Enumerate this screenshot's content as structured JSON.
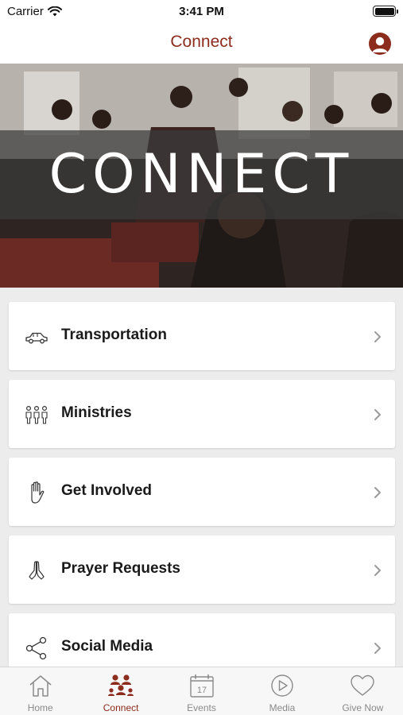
{
  "status_bar": {
    "carrier": "Carrier",
    "time": "3:41 PM"
  },
  "nav": {
    "title": "Connect",
    "profile_icon": "user-profile-icon"
  },
  "hero": {
    "banner_text": "CONNECT"
  },
  "menu": {
    "items": [
      {
        "label": "Transportation",
        "icon": "car-icon"
      },
      {
        "label": "Ministries",
        "icon": "people-group-icon"
      },
      {
        "label": "Get Involved",
        "icon": "raised-hand-icon"
      },
      {
        "label": "Prayer Requests",
        "icon": "praying-hands-icon"
      },
      {
        "label": "Social Media",
        "icon": "share-icon"
      }
    ]
  },
  "tab_bar": {
    "tabs": [
      {
        "label": "Home",
        "icon": "home-icon"
      },
      {
        "label": "Connect",
        "icon": "connect-people-icon",
        "active": true
      },
      {
        "label": "Events",
        "icon": "calendar-icon",
        "calendar_day": "17"
      },
      {
        "label": "Media",
        "icon": "play-icon"
      },
      {
        "label": "Give Now",
        "icon": "heart-icon"
      }
    ]
  },
  "colors": {
    "accent": "#8b2c1d",
    "inactive": "#8a8a8a",
    "background": "#ececec"
  }
}
